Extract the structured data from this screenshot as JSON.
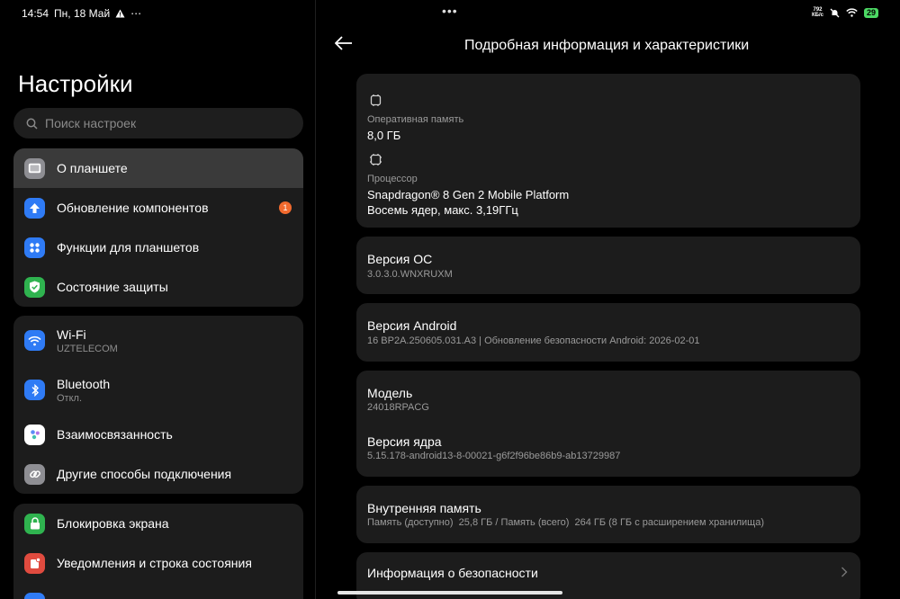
{
  "status": {
    "time": "14:54",
    "date": "Пн, 18 Май",
    "speed_top": "792",
    "speed_bottom": "КБ/с",
    "battery": "29"
  },
  "left": {
    "title": "Настройки",
    "search_placeholder": "Поиск настроек",
    "items": [
      {
        "label": "О планшете",
        "sub": "",
        "color": "#8e8e93",
        "icon": "tablet-icon",
        "selected": true
      },
      {
        "label": "Обновление компонентов",
        "sub": "",
        "color": "#2f7bf5",
        "icon": "update-arrow-icon",
        "badge": "1"
      },
      {
        "label": "Функции для планшетов",
        "sub": "",
        "color": "#2f7bf5",
        "icon": "grid-icon"
      },
      {
        "label": "Состояние защиты",
        "sub": "",
        "color": "#2fb34f",
        "icon": "shield-icon"
      },
      {
        "label": "Wi-Fi",
        "sub": "UZTELECOM",
        "color": "#2f7bf5",
        "icon": "wifi-icon"
      },
      {
        "label": "Bluetooth",
        "sub": "Откл.",
        "color": "#2f7bf5",
        "icon": "bluetooth-icon"
      },
      {
        "label": "Взаимосвязанность",
        "sub": "",
        "color": "#ffffff",
        "icon": "interconnect-icon"
      },
      {
        "label": "Другие способы подключения",
        "sub": "",
        "color": "#8e8e93",
        "icon": "link-icon"
      },
      {
        "label": "Блокировка экрана",
        "sub": "",
        "color": "#2fb34f",
        "icon": "lock-icon"
      },
      {
        "label": "Уведомления и строка состояния",
        "sub": "",
        "color": "#e04b3f",
        "icon": "notification-icon"
      }
    ]
  },
  "right": {
    "title": "Подробная информация и характеристики",
    "ram_label": "Оперативная память",
    "ram_value": "8,0 ГБ",
    "cpu_label": "Процессор",
    "cpu_value1": "Snapdragon® 8 Gen 2 Mobile Platform",
    "cpu_value2": "Восемь ядер, макс. 3,19ГГц",
    "os_label": "Версия ОС",
    "os_value": "3.0.3.0.WNXRUXM",
    "android_label": "Версия Android",
    "android_value": "16 BP2A.250605.031.A3 | Обновление безопасности Android: 2026-02-01",
    "model_label": "Модель",
    "model_value": "24018RPACG",
    "kernel_label": "Версия ядра",
    "kernel_value": "5.15.178-android13-8-00021-g6f2f96be86b9-ab13729987",
    "storage_label": "Внутренняя память",
    "storage_value": "Память (доступно)  25,8 ГБ / Память (всего)  264 ГБ (8 ГБ с расширением хранилища)",
    "security_label": "Информация о безопасности"
  }
}
